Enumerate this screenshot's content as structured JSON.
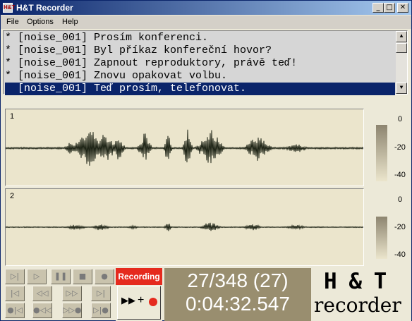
{
  "window": {
    "title": "H&T Recorder",
    "icon_text": "H&T"
  },
  "titlebar_buttons": {
    "minimize": "_",
    "maximize": "□",
    "close": "✕"
  },
  "menu": {
    "file": "File",
    "options": "Options",
    "help": "Help"
  },
  "list": {
    "items": [
      {
        "text": "* [noise_001] Prosím konferenci.",
        "selected": false
      },
      {
        "text": "* [noise_001] Byl příkaz konfereční hovor?",
        "selected": false
      },
      {
        "text": "* [noise_001] Zapnout reproduktory, právě teď!",
        "selected": false
      },
      {
        "text": "* [noise_001] Znovu opakovat volbu.",
        "selected": false
      },
      {
        "text": "  [noise_001] Teď prosím, telefonovat.",
        "selected": true
      }
    ]
  },
  "channels": [
    {
      "label": "1",
      "db_labels": [
        "0",
        "-20",
        "-40"
      ]
    },
    {
      "label": "2",
      "db_labels": [
        "0",
        "-20",
        "-40"
      ]
    }
  ],
  "transport": {
    "buttons": [
      "play-all",
      "play",
      "pause",
      "stop",
      "record-circle",
      "first",
      "rewind",
      "fast-forward",
      "last",
      "prev-marked",
      "rewind-marked",
      "forward-marked",
      "next-marked"
    ]
  },
  "recording": {
    "label": "Recording",
    "plus": "+",
    "action_icon": "next-and-record"
  },
  "counter": {
    "position": "27/348 (27)",
    "time": "0:04:32.547"
  },
  "logo": {
    "line1": "H & T",
    "line2": "recorder"
  },
  "colors": {
    "selection": "#0a246a",
    "recording": "#e52a1e",
    "counter_bg": "#998e6f",
    "wave_bg": "#ebe5cc",
    "wave": "#1e2416"
  }
}
